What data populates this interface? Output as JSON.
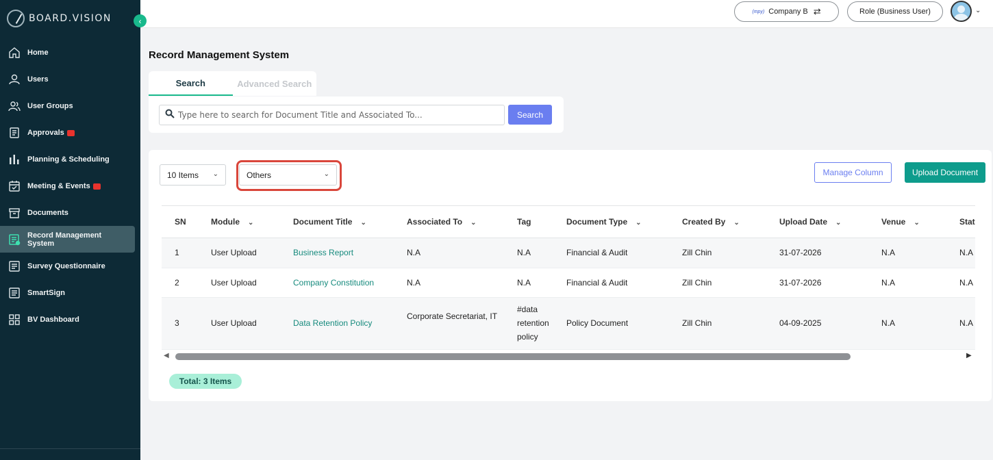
{
  "brand": {
    "name": "BOARD.VISION"
  },
  "sidebar": {
    "items": [
      {
        "label": "Home",
        "icon": "home-icon",
        "badge": false
      },
      {
        "label": "Users",
        "icon": "user-icon",
        "badge": false
      },
      {
        "label": "User Groups",
        "icon": "user-group-icon",
        "badge": false
      },
      {
        "label": "Approvals",
        "icon": "approval-icon",
        "badge": true
      },
      {
        "label": "Planning & Scheduling",
        "icon": "bar-chart-icon",
        "badge": false
      },
      {
        "label": "Meeting & Events",
        "icon": "calendar-icon",
        "badge": true
      },
      {
        "label": "Documents",
        "icon": "archive-icon",
        "badge": false
      },
      {
        "label": "Record Management System",
        "icon": "record-icon",
        "badge": false,
        "active": true
      },
      {
        "label": "Survey Questionnaire",
        "icon": "survey-icon",
        "badge": false
      },
      {
        "label": "SmartSign",
        "icon": "smartsign-icon",
        "badge": false
      },
      {
        "label": "BV Dashboard",
        "icon": "dashboard-grid-icon",
        "badge": false
      }
    ]
  },
  "topbar": {
    "company_logo_text": "(mpy)",
    "company": "Company B",
    "role": "Role (Business User)"
  },
  "page": {
    "title": "Record Management System",
    "tabs": [
      "Search",
      "Advanced Search"
    ],
    "search_placeholder": "Type here to search for Document Title and Associated To...",
    "search_button": "Search",
    "items_select": "10 Items",
    "category_select": "Others",
    "manage_column": "Manage Column",
    "upload_document": "Upload Document",
    "total": "Total: 3 Items"
  },
  "table": {
    "columns": [
      "SN",
      "Module",
      "Document Title",
      "Associated To",
      "Tag",
      "Document Type",
      "Created By",
      "Upload Date",
      "Venue",
      "Stat"
    ],
    "rows": [
      {
        "sn": "1",
        "module": "User Upload",
        "title": "Business Report",
        "associated": "N.A",
        "tag": "N.A",
        "type": "Financial & Audit",
        "created_by": "Zill Chin",
        "date": "31-07-2026",
        "venue": "N.A",
        "status": "N.A"
      },
      {
        "sn": "2",
        "module": "User Upload",
        "title": "Company Constitution",
        "associated": "N.A",
        "tag": "N.A",
        "type": "Financial & Audit",
        "created_by": "Zill Chin",
        "date": "31-07-2026",
        "venue": "N.A",
        "status": "N.A"
      },
      {
        "sn": "3",
        "module": "User Upload",
        "title": "Data Retention Policy",
        "associated": "Corporate Secretariat, IT",
        "tag": "#data retention policy",
        "type": "Policy Document",
        "created_by": "Zill Chin",
        "date": "04-09-2025",
        "venue": "N.A",
        "status": "N.A"
      }
    ]
  },
  "colors": {
    "sidebar": "#0d2a36",
    "accent": "#19b98c",
    "primary": "#6a7ef0",
    "upload": "#0e9c8c",
    "highlight": "#d9463b"
  }
}
